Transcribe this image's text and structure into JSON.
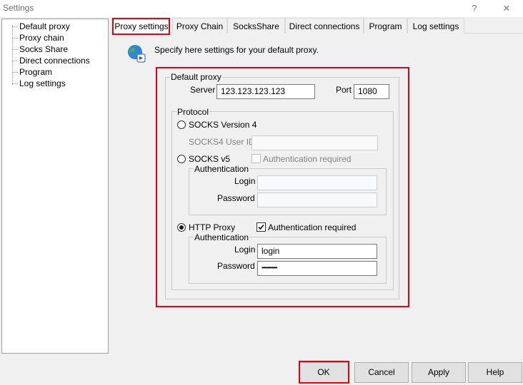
{
  "window": {
    "title": "Settings",
    "help_glyph": "?",
    "close_glyph": "✕"
  },
  "tree": {
    "items": [
      {
        "label": "Default proxy"
      },
      {
        "label": "Proxy chain"
      },
      {
        "label": "Socks Share"
      },
      {
        "label": "Direct connections"
      },
      {
        "label": "Program"
      },
      {
        "label": "Log settings"
      }
    ]
  },
  "tabs": [
    {
      "label": "Proxy settings",
      "active": true
    },
    {
      "label": "Proxy Chain"
    },
    {
      "label": "SocksShare"
    },
    {
      "label": "Direct connections"
    },
    {
      "label": "Program"
    },
    {
      "label": "Log settings"
    }
  ],
  "panel": {
    "info_icon": "globe-icon",
    "description": "Specify here settings for your default proxy.",
    "default_proxy": {
      "legend": "Default proxy",
      "server_label": "Server",
      "server_value": "123.123.123.123",
      "port_label": "Port",
      "port_value": "1080"
    },
    "protocol": {
      "legend": "Protocol",
      "socks4": {
        "label": "SOCKS Version 4",
        "selected": false,
        "userid_label": "SOCKS4 User ID",
        "userid_value": ""
      },
      "socks5": {
        "label": "SOCKS v5",
        "selected": false,
        "auth_required_label": "Authentication required",
        "auth_required": false,
        "auth_legend": "Authentication",
        "login_label": "Login",
        "login_value": "",
        "password_label": "Password",
        "password_value": ""
      },
      "http": {
        "label": "HTTP Proxy",
        "selected": true,
        "auth_required_label": "Authentication required",
        "auth_required": true,
        "auth_legend": "Authentication",
        "login_label": "Login",
        "login_value": "login",
        "password_label": "Password",
        "password_value": "••••••••••••"
      }
    }
  },
  "buttons": {
    "ok": "OK",
    "cancel": "Cancel",
    "apply": "Apply",
    "help": "Help"
  },
  "colors": {
    "highlight": "#e3000f",
    "window_bg": "#f0f0f0"
  }
}
